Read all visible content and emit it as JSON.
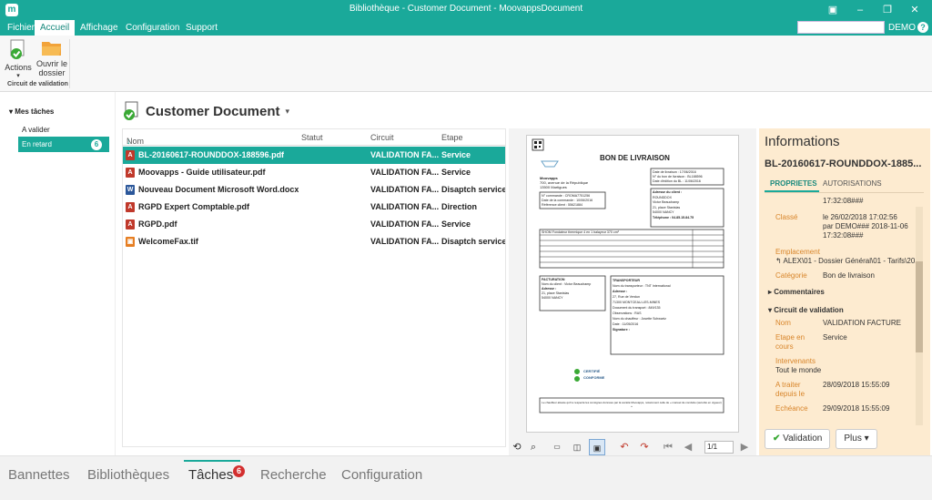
{
  "window": {
    "title": "Bibliothèque - Customer Document - MoovappsDocument",
    "logo_icon": "moovapps-logo-icon"
  },
  "menu": {
    "tabs": [
      {
        "label": "Fichier"
      },
      {
        "label": "Accueil"
      },
      {
        "label": "Affichage"
      },
      {
        "label": "Configuration"
      },
      {
        "label": "Support"
      }
    ],
    "user": "DEMO ▾",
    "help": "?"
  },
  "ribbon": {
    "actions_label": "Actions",
    "open_folder_label_1": "Ouvrir le",
    "open_folder_label_2": "dossier",
    "group_label": "Circuit de validation"
  },
  "sidebar": {
    "section": "Mes tâches",
    "items": [
      {
        "label": "A valider"
      },
      {
        "label": "En retard",
        "badge": "6"
      }
    ]
  },
  "document": {
    "title": "Customer Document"
  },
  "grid": {
    "columns": [
      "Nom",
      "Statut",
      "Circuit",
      "Etape"
    ],
    "rows": [
      {
        "name": "BL-20160617-ROUNDDOX-188596.pdf",
        "status": "",
        "circuit": "VALIDATION FA...",
        "step": "Service",
        "type": "pdf"
      },
      {
        "name": "Moovapps - Guide utilisateur.pdf",
        "status": "",
        "circuit": "VALIDATION FA...",
        "step": "Service",
        "type": "pdf"
      },
      {
        "name": "Nouveau Document Microsoft Word.docx",
        "status": "",
        "circuit": "VALIDATION FA...",
        "step": "Disaptch service",
        "type": "docx"
      },
      {
        "name": "RGPD Expert Comptable.pdf",
        "status": "",
        "circuit": "VALIDATION FA...",
        "step": "Direction",
        "type": "pdf"
      },
      {
        "name": "RGPD.pdf",
        "status": "",
        "circuit": "VALIDATION FA...",
        "step": "Service",
        "type": "pdf"
      },
      {
        "name": "WelcomeFax.tif",
        "status": "",
        "circuit": "VALIDATION FA...",
        "step": "Disaptch service",
        "type": "tif"
      }
    ]
  },
  "preview": {
    "doc_title": "BON DE LIVRAISON",
    "sender": [
      "Moovapps",
      "700, avenue de la République",
      "13500 Martigues"
    ],
    "header_box": [
      "Date de livraison : 17/06/2016",
      "N° du bon de livraison : BL188596",
      "Date d'édition du BL : 11/06/2016"
    ],
    "order_box": [
      "N° commande : CROMA7751256",
      "Date de la commande : 10/06/2016",
      "Référence client : 55621884"
    ],
    "client_box": [
      "Adresse du client :",
      "ROUNDDOX",
      "Victor Beauchamp",
      "21, place Stanislas",
      "54000 NANCY",
      "Téléphone : 04.85.15.84.75"
    ],
    "product_line": "SHOM Fondateur thermique 4 en 1 balayeur 370 cm²",
    "billing_title": "FACTURATION",
    "billing_lines": [
      "Nom du client : Victor Beauchamp",
      "Adresse :",
      "21, place Stanislas",
      "54000 NANCY"
    ],
    "carrier_title": "TRANSPORTEUR",
    "carrier_lines": [
      "Nom du transporteur : TNT International",
      "Adresse :",
      "27, Rue de Verdun",
      "71300 MONTCEAU-LES-MINES",
      "Document du transport : 849/135",
      "Observations : RAS",
      "Nom du chauffeur : Josette Schwartz",
      "Date : 11/05/2016",
      "Signature :"
    ],
    "certified_1": "CERTIFIÉ",
    "certified_2": "CONFORME",
    "footer_note": "Le chauffeur atteste qu'il a respecté les consignes données par la société Moovapps, notamment celle de « manuel de conduite (sécurité en vigueur) »",
    "page_indicator": "1/1"
  },
  "info": {
    "heading": "Informations",
    "filename": "BL-20160617-ROUNDDOX-1885...",
    "tabs": [
      "PROPRIETES",
      "AUTORISATIONS"
    ],
    "props": {
      "classed_time": "17:32:08###",
      "classed_label": "Classé",
      "classed_value_1": "le 26/02/2018 17:02:56",
      "classed_value_2": "par DEMO### 2018-11-06",
      "classed_value_3": "17:32:08###",
      "location_label": "Emplacement",
      "location_value": "↰ ALEX\\01 - Dossier Général\\01 - Tarifs\\2018",
      "category_label": "Catégorie",
      "category_value": "Bon de livraison",
      "comments_section": "Commentaires",
      "circuit_section": "Circuit de validation",
      "name_label": "Nom",
      "name_value": "VALIDATION FACTURE",
      "step_label_1": "Etape en",
      "step_label_2": "cours",
      "step_value": "Service",
      "actors_label": "Intervenants",
      "actors_value": "Tout le monde",
      "todo_label_1": "A traiter",
      "todo_label_2": "depuis le",
      "todo_value": "28/09/2018 15:55:09",
      "due_label": "Echéance",
      "due_value": "29/09/2018 15:55:09"
    },
    "validate_button": "Validation",
    "more_button": "Plus"
  },
  "bottom": {
    "tabs": [
      {
        "label": "Bannettes"
      },
      {
        "label": "Bibliothèques"
      },
      {
        "label": "Tâches",
        "badge": "6"
      },
      {
        "label": "Recherche"
      },
      {
        "label": "Configuration"
      }
    ]
  }
}
